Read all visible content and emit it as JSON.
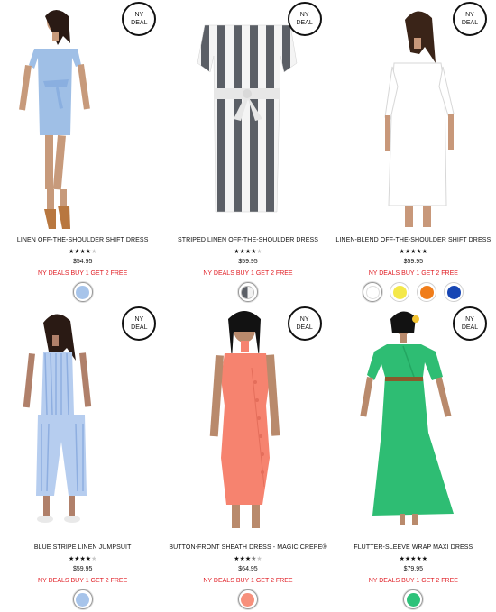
{
  "badge": {
    "line1": "NY",
    "line2": "DEAL"
  },
  "products": [
    {
      "name": "LINEN OFF-THE-SHOULDER SHIFT DRESS",
      "rating": 4,
      "price": "$54.95",
      "deal": "NY DEALS BUY 1 GET 2 FREE",
      "swatches": [
        {
          "color": "#a7c4ea",
          "label": "blue"
        }
      ],
      "dress": "shift-blue"
    },
    {
      "name": "STRIPED LINEN OFF-THE-SHOULDER DRESS",
      "rating": 4,
      "price": "$59.95",
      "deal": "NY DEALS BUY 1 GET 2 FREE",
      "swatches": [
        {
          "color": "half-grey",
          "label": "grey-white"
        }
      ],
      "dress": "stripe"
    },
    {
      "name": "LINEN-BLEND OFF-THE-SHOULDER SHIFT DRESS",
      "rating": 5,
      "price": "$59.95",
      "deal": "NY DEALS BUY 1 GET 2 FREE",
      "swatches": [
        {
          "color": "#ffffff",
          "label": "white"
        },
        {
          "color": "#f4e84a",
          "label": "yellow"
        },
        {
          "color": "#f07d1a",
          "label": "orange"
        },
        {
          "color": "#1746b4",
          "label": "blue"
        }
      ],
      "dress": "white"
    },
    {
      "name": "BLUE STRIPE LINEN JUMPSUIT",
      "rating": 4,
      "price": "$59.95",
      "deal": "NY DEALS BUY 1 GET 2 FREE",
      "swatches": [
        {
          "color": "#a7c4ea",
          "label": "blue"
        }
      ],
      "dress": "jumpsuit"
    },
    {
      "name": "BUTTON-FRONT SHEATH DRESS - MAGIC CREPE®",
      "rating": 3.5,
      "price": "$64.95",
      "deal": "NY DEALS BUY 1 GET 2 FREE",
      "swatches": [
        {
          "color": "#f7907c",
          "label": "coral"
        }
      ],
      "dress": "coral"
    },
    {
      "name": "FLUTTER-SLEEVE WRAP MAXI DRESS",
      "rating": 5,
      "price": "$79.95",
      "deal": "NY DEALS BUY 1 GET 2 FREE",
      "swatches": [
        {
          "color": "#2ec27a",
          "label": "green"
        }
      ],
      "dress": "green"
    }
  ]
}
